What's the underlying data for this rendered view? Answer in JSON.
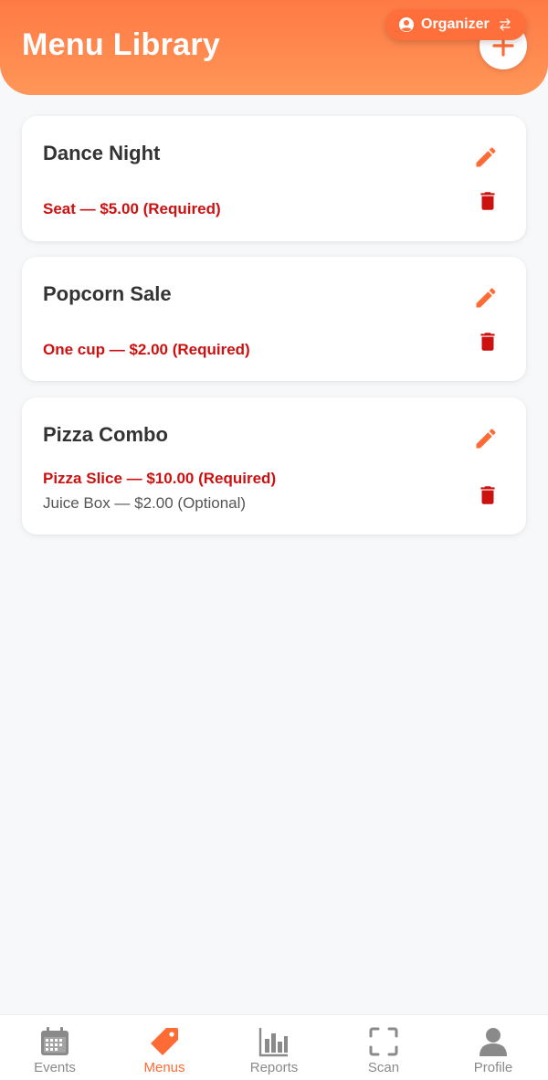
{
  "header": {
    "title": "Menu Library",
    "add_icon": "plus-icon",
    "role_chip": {
      "label": "Organizer",
      "icon": "user-circle-icon",
      "switch_icon": "swap-arrows-icon"
    }
  },
  "colors": {
    "accent": "#ff6b35",
    "required": "#cc1111",
    "delete": "#cc1111"
  },
  "menus": [
    {
      "title": "Dance Night",
      "items": [
        {
          "text": "Seat — $5.00 (Required)",
          "required": true
        }
      ]
    },
    {
      "title": "Popcorn Sale",
      "items": [
        {
          "text": "One cup — $2.00 (Required)",
          "required": true
        }
      ]
    },
    {
      "title": "Pizza Combo",
      "items": [
        {
          "text": "Pizza Slice — $10.00 (Required)",
          "required": true
        },
        {
          "text": "Juice Box — $2.00 (Optional)",
          "required": false
        }
      ]
    }
  ],
  "nav": [
    {
      "label": "Events",
      "icon": "calendar-icon",
      "active": false
    },
    {
      "label": "Menus",
      "icon": "tag-icon",
      "active": true
    },
    {
      "label": "Reports",
      "icon": "bar-chart-icon",
      "active": false
    },
    {
      "label": "Scan",
      "icon": "scan-frame-icon",
      "active": false
    },
    {
      "label": "Profile",
      "icon": "user-icon",
      "active": false
    }
  ]
}
